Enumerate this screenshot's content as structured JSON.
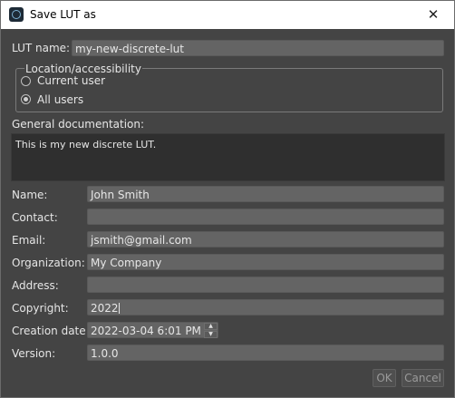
{
  "window": {
    "title": "Save LUT as",
    "close_glyph": "✕"
  },
  "lut_name": {
    "label": "LUT name:",
    "value": "my-new-discrete-lut"
  },
  "location": {
    "title": "Location/accessibility",
    "options": [
      {
        "label": "Current user",
        "checked": false
      },
      {
        "label": "All users",
        "checked": true
      }
    ]
  },
  "documentation": {
    "label": "General documentation:",
    "value": "This is my new discrete LUT."
  },
  "fields": {
    "name": {
      "label": "Name:",
      "value": "John Smith"
    },
    "contact": {
      "label": "Contact:",
      "value": ""
    },
    "email": {
      "label": "Email:",
      "value": "jsmith@gmail.com"
    },
    "organization": {
      "label": "Organization:",
      "value": "My Company"
    },
    "address": {
      "label": "Address:",
      "value": ""
    },
    "copyright": {
      "label": "Copyright:",
      "value": "2022"
    },
    "creation_date": {
      "label": "Creation date:",
      "value": "2022-03-04 6:01 PM"
    },
    "version": {
      "label": "Version:",
      "value": "1.0.0"
    }
  },
  "buttons": {
    "ok": "OK",
    "cancel": "Cancel"
  },
  "colors": {
    "background": "#444444",
    "field": "#646464",
    "doc_field": "#2f2f2f",
    "text": "#e6e6e6",
    "disabled_text": "#9a9a9a"
  }
}
